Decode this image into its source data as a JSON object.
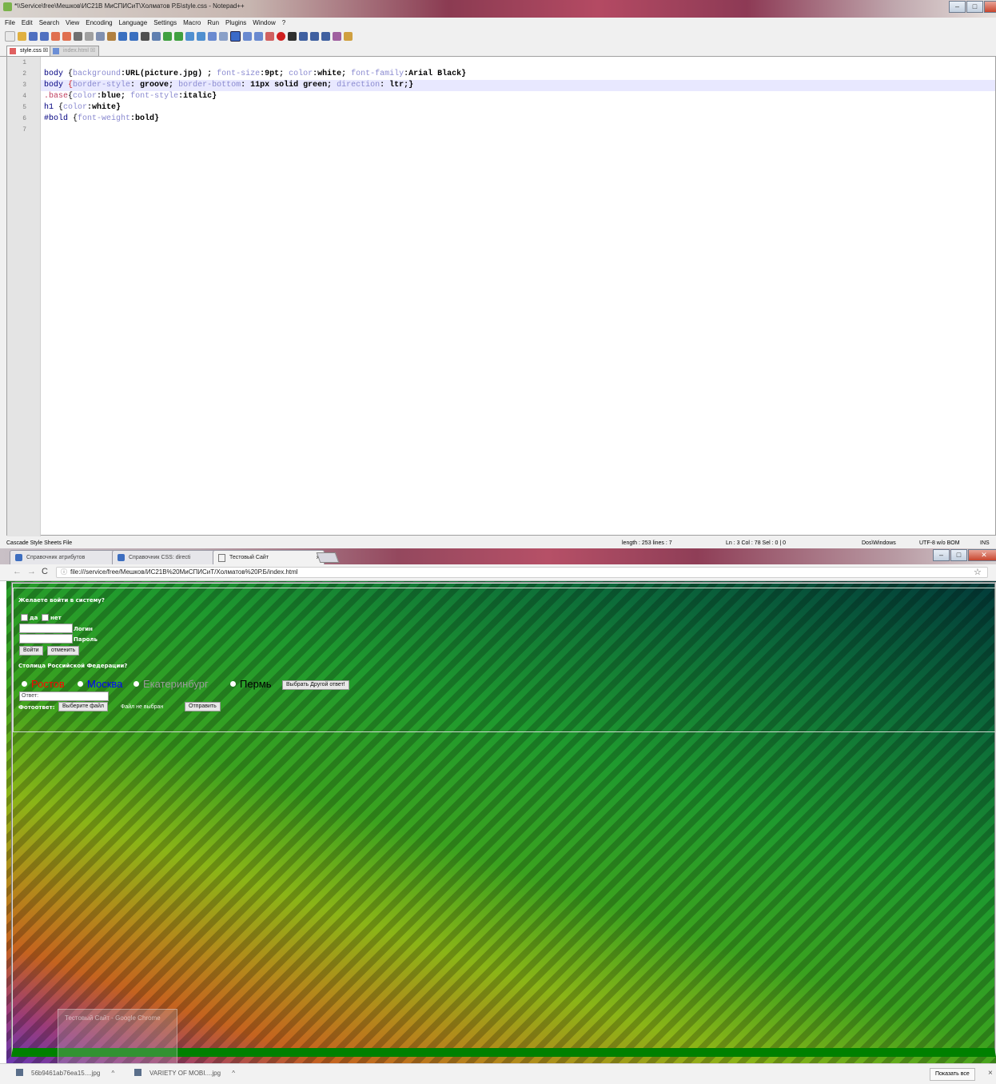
{
  "npp": {
    "title": "*\\\\Service\\free\\Мешков\\ИС21В МиСПИСиТ\\Холматов Р.Б\\style.css - Notepad++",
    "menu": [
      "File",
      "Edit",
      "Search",
      "View",
      "Encoding",
      "Language",
      "Settings",
      "Macro",
      "Run",
      "Plugins",
      "Window",
      "?"
    ],
    "tabs": [
      "style.css",
      "index.html"
    ],
    "line_numbers": [
      "1",
      "2",
      "3",
      "4",
      "5",
      "6",
      "7"
    ],
    "code": {
      "l2": [
        "body",
        " {",
        "background",
        ":URL(picture.jpg) ; ",
        "font-size",
        ":9pt; ",
        "color",
        ":white; ",
        "font-family",
        ":Arial Black}"
      ],
      "l3": [
        "body",
        " {",
        "border-style",
        ": groove; ",
        "border-bottom",
        ": 11px solid green; ",
        "direction",
        ": ltr;}"
      ],
      "l4": [
        ".base",
        "{",
        "color",
        ":blue; ",
        "font-style",
        ":italic}"
      ],
      "l5": [
        "h1",
        " {",
        "color",
        ":white}"
      ],
      "l6": [
        "#bold",
        " {",
        "font-weight",
        ":bold}"
      ]
    },
    "status": {
      "type": "Cascade Style Sheets File",
      "length": "length : 253    lines : 7",
      "pos": "Ln : 3    Col : 78    Sel : 0 | 0",
      "eol": "Dos\\Windows",
      "enc": "UTF-8 w/o BOM",
      "mode": "INS"
    }
  },
  "chrome": {
    "tabs": [
      "Справочник атрибутов",
      "Справочник CSS: directi",
      "Тестовый Сайт"
    ],
    "close": "×",
    "url": "file:///service/free/Мешков/ИС21В%20МиСПИСиТ/Холматов%20Р.Б/index.html",
    "star": "☆"
  },
  "page": {
    "question1": "Желаете войти в систему?",
    "opt_yes": "да",
    "opt_no": "нет",
    "login_label": "Логин",
    "password_label": "Пароль",
    "login_button": "Войти",
    "cancel_button": "отменить",
    "question2": "Столица Российской Федерации?",
    "cities": [
      {
        "name": "Ростов",
        "color": "#ff0000"
      },
      {
        "name": "Москва",
        "color": "#0000ff"
      },
      {
        "name": "Екатеринбург",
        "color": "#9a9a9a"
      },
      {
        "name": "Пермь",
        "color": "#000000"
      }
    ],
    "other_answer_button": "Выбрать Другой ответ!",
    "answer_placeholder": "Ответ:",
    "photo_label": "Фотоответ:",
    "file_button": "Выберите файл",
    "file_status": "Файл не выбран",
    "submit_button": "Отправить",
    "ghost_preview": "Тестовый Сайт - Google Chrome"
  },
  "downloads": {
    "items": [
      "56b9461ab76ea15....jpg",
      "VARIETY OF MOBI....jpg"
    ],
    "caret": "^",
    "show_all": "Показать все",
    "close": "×"
  },
  "colors": {
    "border_bottom": "#008000",
    "keyword": "#000080",
    "property": "#8a8ad0"
  }
}
